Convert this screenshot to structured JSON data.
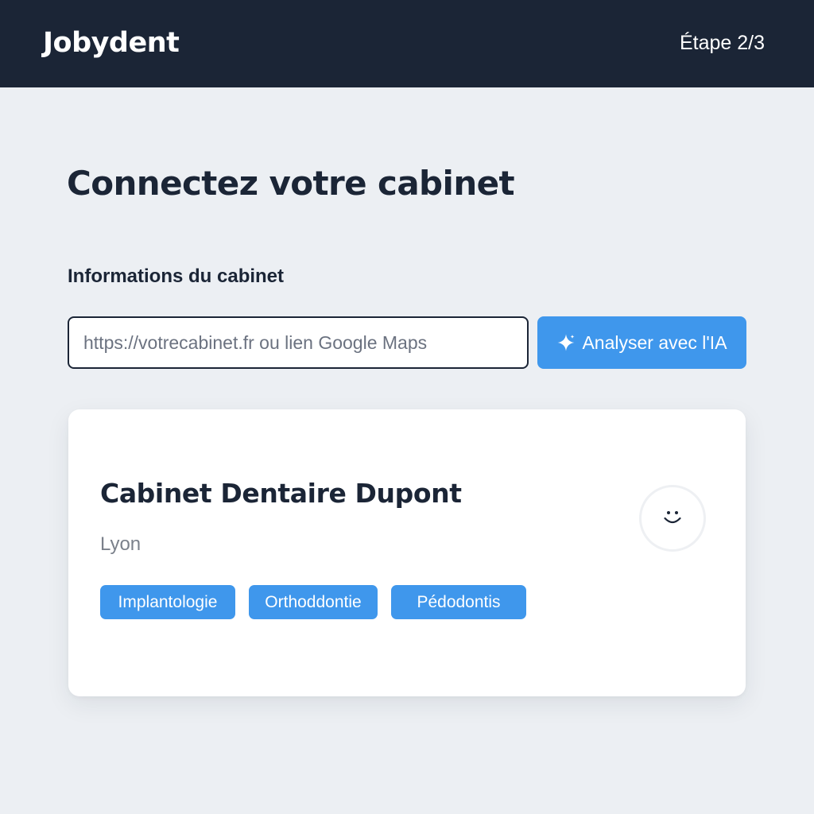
{
  "header": {
    "logo": "Jobydent",
    "step": "Étape 2/3"
  },
  "main": {
    "title": "Connectez votre cabinet",
    "section_label": "Informations du cabinet",
    "url_input": {
      "value": "",
      "placeholder": "https://votrecabinet.fr ou lien Google Maps"
    },
    "analyze_button": {
      "label": "Analyser avec l'IA",
      "icon": "sparkle-icon"
    }
  },
  "card": {
    "name": "Cabinet Dentaire Dupont",
    "city": "Lyon",
    "tags": [
      "Implantologie",
      "Orthoddontie",
      "Pédodontis"
    ],
    "avatar_icon": "smiley-icon"
  },
  "colors": {
    "header_bg": "#1b2536",
    "accent": "#3f97ec",
    "page_bg": "#eceff3",
    "text_dark": "#1b2536",
    "text_muted": "#7b818b"
  }
}
